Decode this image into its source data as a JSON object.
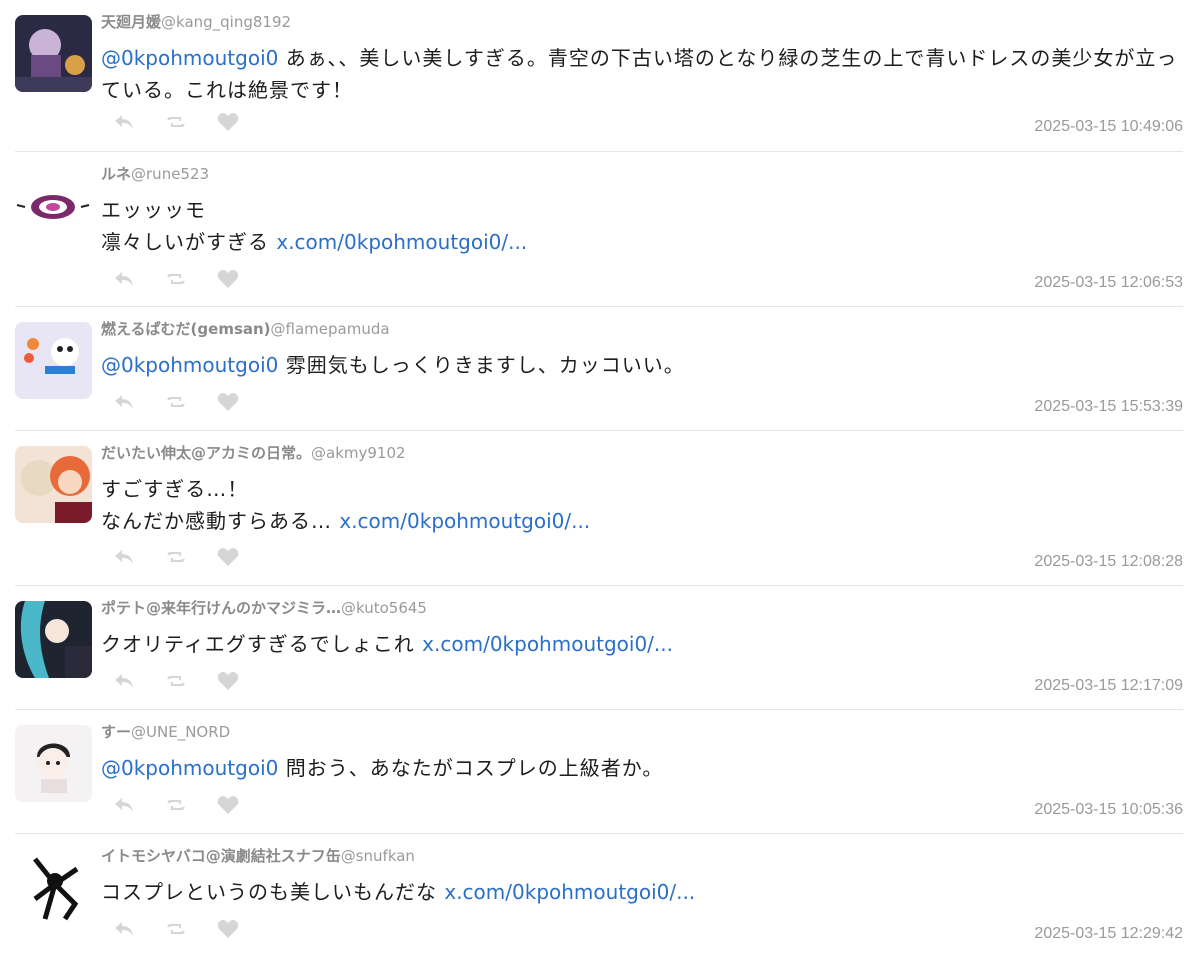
{
  "replies": [
    {
      "name": "天廻月媛",
      "handle": "@kang_qing8192",
      "mention": "@0kpohmoutgoi0",
      "text": " あぁ、、美しい美しすぎる。青空の下古い塔のとなり緑の芝生の上で青いドレスの美少女が立っている。これは絶景です！",
      "line2": "",
      "link": "",
      "time": "2025-03-15 10:49:06"
    },
    {
      "name": "ルネ",
      "handle": "@rune523",
      "mention": "",
      "text": "エッッッモ",
      "line2": "凛々しいがすぎる ",
      "link": "x.com/0kpohmoutgoi0/...",
      "time": "2025-03-15 12:06:53"
    },
    {
      "name": "燃えるぱむだ(gemsan)",
      "handle": "@flamepamuda",
      "mention": "@0kpohmoutgoi0",
      "text": " 雰囲気もしっくりきますし、カッコいい。",
      "line2": "",
      "link": "",
      "time": "2025-03-15 15:53:39"
    },
    {
      "name": "だいたい伸太@アカミの日常。",
      "handle": "@akmy9102",
      "mention": "",
      "text": "すごすぎる…！",
      "line2": "なんだか感動すらある… ",
      "link": "x.com/0kpohmoutgoi0/...",
      "time": "2025-03-15 12:08:28"
    },
    {
      "name": "ポテト@来年行けんのかマジミラ…",
      "handle": "@kuto5645",
      "mention": "",
      "text": "クオリティエグすぎるでしょこれ ",
      "line2": "",
      "link": "x.com/0kpohmoutgoi0/...",
      "time": "2025-03-15 12:17:09"
    },
    {
      "name": "すー",
      "handle": "@UNE_NORD",
      "mention": "@0kpohmoutgoi0",
      "text": " 問おう、あなたがコスプレの上級者か。",
      "line2": "",
      "link": "",
      "time": "2025-03-15 10:05:36"
    },
    {
      "name": "イトモシヤバコ@演劇結社スナフ缶",
      "handle": "@snufkan",
      "mention": "",
      "text": "コスプレというのも美しいもんだな ",
      "line2": "",
      "link": "x.com/0kpohmoutgoi0/...",
      "time": "2025-03-15 12:29:42"
    }
  ],
  "icons": {
    "reply": "reply-icon",
    "retweet": "retweet-icon",
    "like": "heart-icon"
  },
  "colors": {
    "link": "#2a6fc9",
    "meta": "#9a9a9a",
    "icon": "#d6d6d6",
    "divider": "#e6e6e6"
  }
}
